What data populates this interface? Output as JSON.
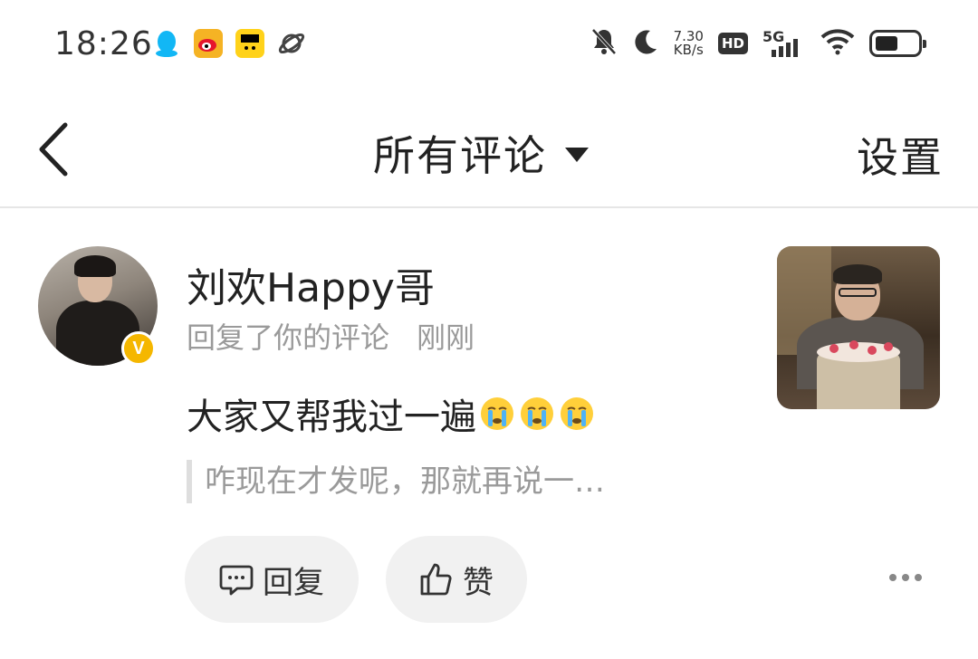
{
  "status_bar": {
    "time": "18:26",
    "net_speed_value": "7.30",
    "net_speed_unit": "KB/s",
    "hd_label": "HD",
    "network_label": "5G",
    "icons": [
      "qq-icon",
      "weibo-icon",
      "kuaikan-icon",
      "orbit-icon",
      "mute-bell-icon",
      "moon-icon",
      "signal-icon",
      "wifi-icon",
      "battery-icon"
    ]
  },
  "header": {
    "title": "所有评论",
    "settings_label": "设置"
  },
  "comment": {
    "username": "刘欢Happy哥",
    "action": "回复了你的评论",
    "time": "刚刚",
    "text": "大家又帮我过一遍",
    "emoji_count": 3,
    "quoted_text": "咋现在才发呢，那就再说一…",
    "reply_label": "回复",
    "like_label": "赞",
    "verified_badge": "V"
  },
  "colors": {
    "badge": "#f5b700",
    "muted_text": "#9a9a9a",
    "button_bg": "#f1f1f1"
  }
}
